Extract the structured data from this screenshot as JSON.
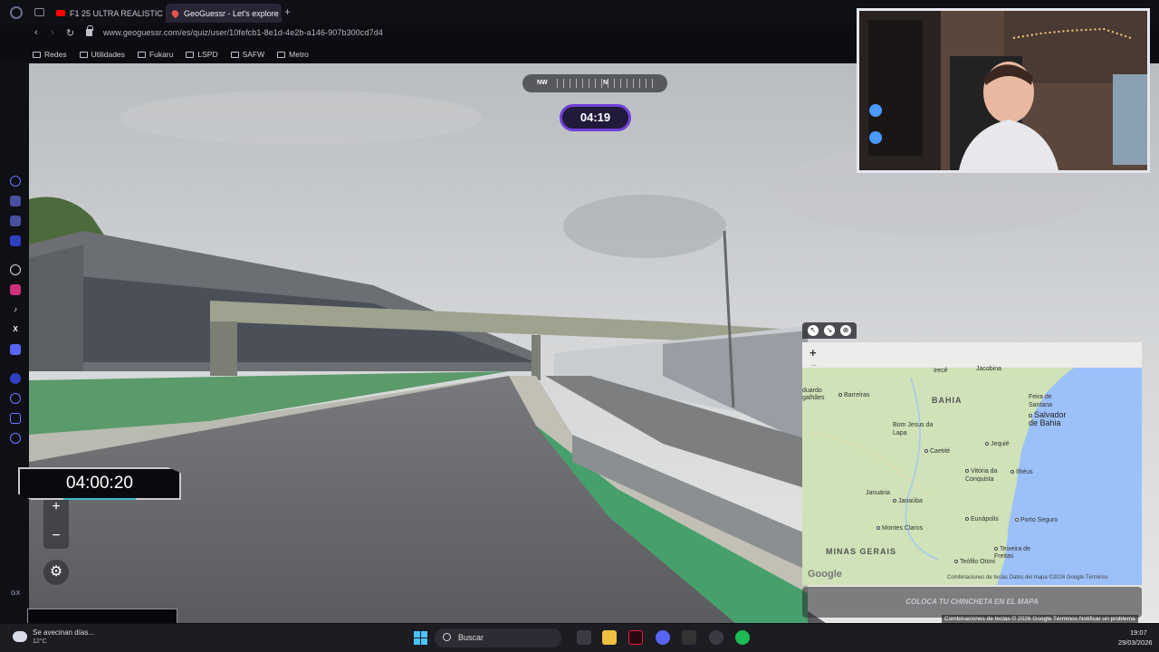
{
  "browser": {
    "tabs": [
      {
        "label": "F1 25 ULTRA REALISTIC C",
        "active": false,
        "icon": "youtube-icon"
      },
      {
        "label": "GeoGuessr - Let's explore",
        "active": true,
        "icon": "geoguessr-pin-icon"
      }
    ],
    "new_tab": "+",
    "url": "www.geoguessr.com/es/quiz/user/10fefcb1-8e1d-4e2b-a146-907b300cd7d4",
    "bookmarks": [
      "Redes",
      "Utilidades",
      "Fukaru",
      "LSPD",
      "SAFW",
      "Metro"
    ],
    "sidebar_label": "GX"
  },
  "game": {
    "compass": {
      "left": "NW",
      "center": "N"
    },
    "round_timer": "04:19",
    "zoom_in": "+",
    "zoom_out": "−",
    "settings_icon": "⚙"
  },
  "stream_overlay": {
    "stopwatch": "04:00:20"
  },
  "minimap": {
    "places": {
      "bahia": "BAHIA",
      "minas": "MINAS GERAIS",
      "salvador": "Salvador de Bahia",
      "feira": "Feira de Santana",
      "barreiras": "Barreiras",
      "bomjesus": "Bom Jesus da Lapa",
      "caetite": "Caetité",
      "jequie": "Jequié",
      "vitoria": "Vitória da Conquista",
      "ilheus": "Ilhéus",
      "januaria": "Januária",
      "janauba": "Janaúba",
      "eunapolis": "Eunápolis",
      "porto": "Porto Seguro",
      "montes": "Montes Claros",
      "teofilo": "Teófilo Otoni",
      "teixeira": "Teixeira de Freitas",
      "irece": "Irecê",
      "jacobina": "Jacobina",
      "eduardo": "duardo",
      "galhaes": "galhães"
    },
    "google_logo": "Google",
    "attribution": "Combinaciones de teclas   Datos del mapa ©2026 Google   Términos",
    "place_button": "COLOCA TU CHINCHETA EN EL MAPA",
    "page_attribution": "Combinaciones de teclas   © 2026 Google   Términos   Notificar un problema"
  },
  "taskbar": {
    "weather_text": "Se avecinan días...",
    "weather_temp": "12°C",
    "search_label": "Buscar",
    "time": "19:07",
    "date": "29/03/2026"
  },
  "colors": {
    "timer_border": "#7040d8",
    "ocean": "#9cc0f9",
    "land": "#cfe2b8"
  }
}
